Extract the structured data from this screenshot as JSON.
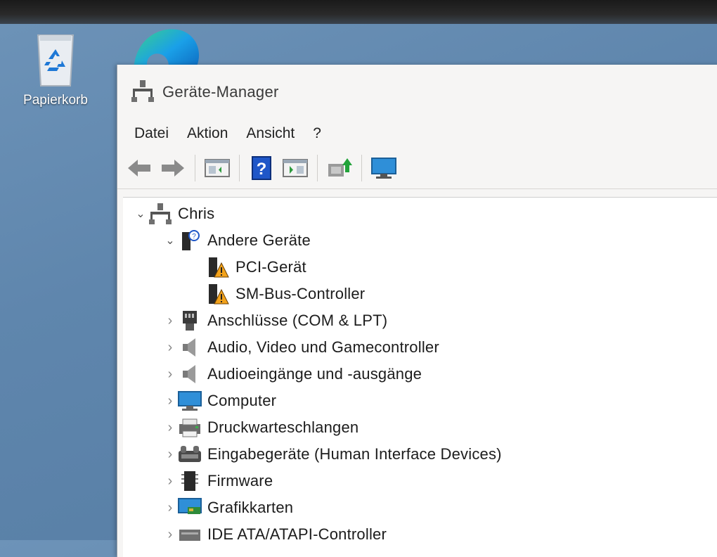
{
  "desktop": {
    "recycle_bin_label": "Papierkorb"
  },
  "window": {
    "title": "Geräte-Manager"
  },
  "menu": [
    "Datei",
    "Aktion",
    "Ansicht",
    "?"
  ],
  "toolbar": {
    "buttons": [
      "back-icon",
      "forward-icon",
      "properties-icon",
      "help-icon",
      "scan-icon",
      "update-driver-icon",
      "monitor-icon"
    ]
  },
  "tree": {
    "root": "Chris",
    "items": [
      {
        "label": "Andere Geräte",
        "level": 1,
        "expanded": true,
        "icon": "unknown-device-icon"
      },
      {
        "label": "PCI-Gerät",
        "level": 2,
        "icon": "warning-device-icon"
      },
      {
        "label": "SM-Bus-Controller",
        "level": 2,
        "icon": "warning-device-icon"
      },
      {
        "label": "Anschlüsse (COM & LPT)",
        "level": 1,
        "expanded": false,
        "icon": "port-icon"
      },
      {
        "label": "Audio, Video und Gamecontroller",
        "level": 1,
        "expanded": false,
        "icon": "speaker-icon"
      },
      {
        "label": "Audioeingänge und -ausgänge",
        "level": 1,
        "expanded": false,
        "icon": "speaker-icon"
      },
      {
        "label": "Computer",
        "level": 1,
        "expanded": false,
        "icon": "computer-icon"
      },
      {
        "label": "Druckwarteschlangen",
        "level": 1,
        "expanded": false,
        "icon": "printer-icon"
      },
      {
        "label": "Eingabegeräte (Human Interface Devices)",
        "level": 1,
        "expanded": false,
        "icon": "hid-icon"
      },
      {
        "label": "Firmware",
        "level": 1,
        "expanded": false,
        "icon": "firmware-icon"
      },
      {
        "label": "Grafikkarten",
        "level": 1,
        "expanded": false,
        "icon": "display-adapter-icon"
      },
      {
        "label": "IDE ATA/ATAPI-Controller",
        "level": 1,
        "expanded": false,
        "icon": "ide-icon"
      }
    ]
  }
}
